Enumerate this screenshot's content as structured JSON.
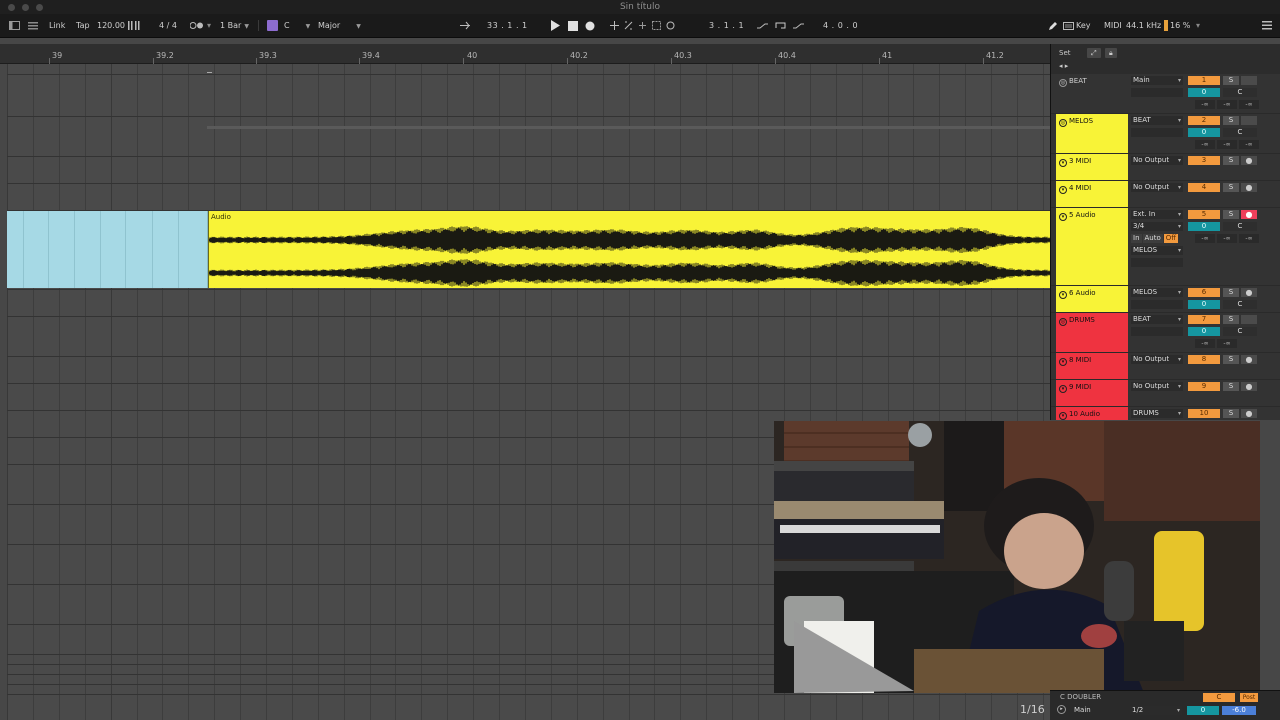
{
  "window": {
    "title": "Sin título"
  },
  "control_bar": {
    "link": "Link",
    "tap": "Tap",
    "tempo": "120.00",
    "time_signature": "4 / 4",
    "quantize": "1 Bar",
    "scale_root": "C",
    "scale_mode": "Major",
    "arrangement_position": "33 .   1 .   1",
    "loop_start": "3 .   1 .   1",
    "loop_length": "4 .   0 .   0",
    "key_label": "Key",
    "midi_label": "MIDI",
    "sample_rate": "44.1 kHz",
    "cpu_load": "16 %",
    "accent_color": "#8d6cd0"
  },
  "ruler": {
    "labels": [
      "39",
      "39.2",
      "39.3",
      "39.4",
      "40",
      "40.2",
      "40.3",
      "40.4",
      "41",
      "41.2"
    ]
  },
  "arrangement": {
    "clip_name": "Audio",
    "clip_color": "#f8f337",
    "loop_color": "#a6d9e5"
  },
  "mixer": {
    "set_label": "Set",
    "tracks": [
      {
        "name": "BEAT",
        "color": "#333333",
        "routing": "Main",
        "number": "1",
        "solo": "S",
        "arm": "",
        "volume": "0",
        "pan": "C",
        "peaks": [
          "-∞",
          "-∞",
          "-∞"
        ]
      },
      {
        "name": "MELOS",
        "color": "#f8f337",
        "routing": "BEAT",
        "number": "2",
        "solo": "S",
        "arm": "",
        "volume": "0",
        "pan": "C",
        "peaks": [
          "-∞",
          "-∞",
          "-∞"
        ]
      },
      {
        "name": "3 MIDI",
        "color": "#f8f337",
        "routing": "No Output",
        "number": "3",
        "solo": "S",
        "arm": "●"
      },
      {
        "name": "4 MIDI",
        "color": "#f8f337",
        "routing": "No Output",
        "number": "4",
        "solo": "S",
        "arm": "●"
      },
      {
        "name": "5 Audio",
        "color": "#f8f337",
        "routing": "Ext. In",
        "input_channel": "3/4",
        "output": "MELOS",
        "number": "5",
        "solo": "S",
        "arm": "●",
        "volume": "0",
        "pan": "C",
        "peaks": [
          "-∞",
          "-∞",
          "-∞"
        ],
        "monitor": [
          "In",
          "Auto",
          "Off"
        ]
      },
      {
        "name": "6 Audio",
        "color": "#f8f337",
        "routing": "MELOS",
        "number": "6",
        "solo": "S",
        "arm": "●",
        "volume": "0",
        "pan": "C"
      },
      {
        "name": "DRUMS",
        "color": "#ef3340",
        "routing": "BEAT",
        "number": "7",
        "solo": "S",
        "arm": "",
        "volume": "0",
        "pan": "C",
        "peaks": [
          "-∞",
          "-∞"
        ]
      },
      {
        "name": "8 MIDI",
        "color": "#ef3340",
        "routing": "No Output",
        "number": "8",
        "solo": "S",
        "arm": "●"
      },
      {
        "name": "9 MIDI",
        "color": "#ef3340",
        "routing": "No Output",
        "number": "9",
        "solo": "S",
        "arm": "●"
      },
      {
        "name": "10 Audio",
        "color": "#ef3340",
        "routing": "DRUMS",
        "number": "10",
        "solo": "S",
        "arm": "●"
      }
    ]
  },
  "bottom": {
    "page_indicator": "1/16",
    "return_track": "C DOUBLER",
    "master_label": "Main",
    "master_routing": "1/2",
    "master_volume": "0",
    "master_gain": "-6.0",
    "post_label": "Post"
  }
}
